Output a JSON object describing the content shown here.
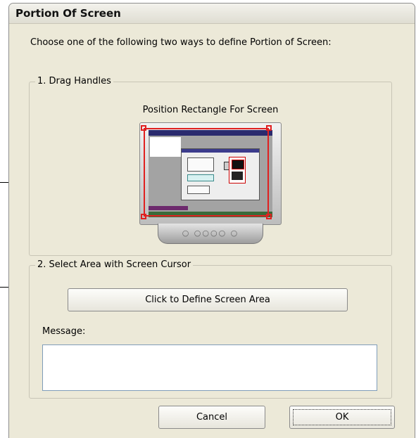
{
  "window": {
    "title": "Portion Of Screen"
  },
  "instruction": "Choose one of the following two ways to define Portion of Screen:",
  "group_drag": {
    "legend": "1. Drag Handles",
    "label": "Position Rectangle For Screen"
  },
  "group_select": {
    "legend": "2. Select Area with Screen Cursor",
    "define_button": "Click to Define Screen Area",
    "message_label": "Message:",
    "message_value": ""
  },
  "buttons": {
    "cancel": "Cancel",
    "ok": "OK"
  },
  "monitor_dots": "○ ○○○○ ○",
  "colors": {
    "selection_red": "#e02020",
    "dialog_bg": "#ece9d8"
  }
}
